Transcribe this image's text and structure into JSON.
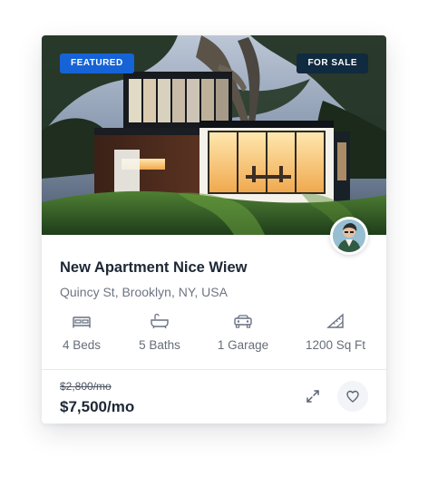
{
  "listing": {
    "badges": {
      "featured": "FEATURED",
      "for_sale": "FOR SALE"
    },
    "title": "New Apartment Nice Wiew",
    "address": "Quincy St, Brooklyn, NY, USA",
    "features": [
      {
        "icon": "bed-icon",
        "label": "4 Beds"
      },
      {
        "icon": "bathtub-icon",
        "label": "5 Baths"
      },
      {
        "icon": "car-icon",
        "label": "1 Garage"
      },
      {
        "icon": "ruler-triangle-icon",
        "label": "1200 Sq Ft"
      }
    ],
    "old_price": "$2,800/mo",
    "price": "$7,500/mo",
    "actions": {
      "expand_icon": "expand-icon",
      "favorite_icon": "heart-icon"
    }
  },
  "colors": {
    "featured_badge": "#1663d8",
    "sale_badge": "#102a3f",
    "title_text": "#1d2735",
    "muted_text": "#6e7582"
  }
}
